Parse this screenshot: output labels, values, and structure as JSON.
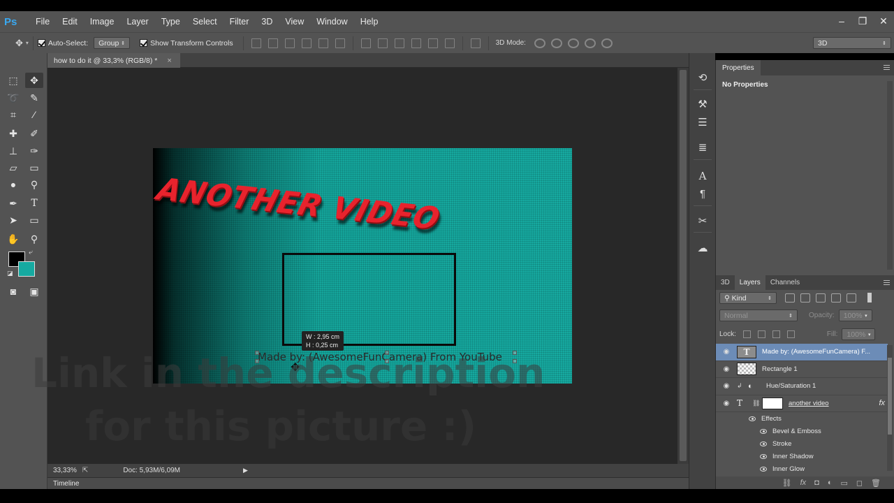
{
  "app": {
    "logo": "Ps",
    "menu": [
      "File",
      "Edit",
      "Image",
      "Layer",
      "Type",
      "Select",
      "Filter",
      "3D",
      "View",
      "Window",
      "Help"
    ],
    "window_controls": {
      "minimize": "–",
      "restore": "❐",
      "close": "✕"
    }
  },
  "options_bar": {
    "auto_select_label": "Auto-Select:",
    "auto_select_value": "Group",
    "show_transform_label": "Show Transform Controls",
    "mode_3d_label": "3D Mode:",
    "workspace_value": "3D"
  },
  "document": {
    "tab_title": "how to do it @ 33,3% (RGB/8) *",
    "tab_close": "×",
    "zoom": "33,33%",
    "doc_info": "Doc: 5,93M/6,09M",
    "timeline_label": "Timeline"
  },
  "canvas": {
    "title_text": "ANOTHER VIDEO",
    "credit_text": "Made by: (AwesomeFunCamera) From YouTube",
    "tooltip_w": "W :  2,95 cm",
    "tooltip_h": "H :  0,25 cm"
  },
  "overlay": {
    "line1": "Link in the description",
    "line2": "for this picture :)"
  },
  "properties": {
    "tab": "Properties",
    "body": "No Properties"
  },
  "layers_panel": {
    "tabs": [
      "3D",
      "Layers",
      "Channels"
    ],
    "active_tab": "Layers",
    "kind_label": "Kind",
    "blend_mode": "Normal",
    "opacity_label": "Opacity:",
    "opacity_value": "100%",
    "lock_label": "Lock:",
    "fill_label": "Fill:",
    "fill_value": "100%",
    "layers": [
      {
        "name": "Made by: (AwesomeFunCamera) F...",
        "type": "text",
        "selected": true
      },
      {
        "name": "Rectangle 1",
        "type": "shape",
        "selected": false
      },
      {
        "name": "Hue/Saturation 1",
        "type": "adjustment",
        "selected": false
      },
      {
        "name": "another video",
        "type": "text-fx",
        "selected": false
      }
    ],
    "effects_label": "Effects",
    "effects": [
      "Bevel & Emboss",
      "Stroke",
      "Inner Shadow",
      "Inner Glow"
    ],
    "fx_label": "fx"
  },
  "colors": {
    "canvas_teal": "#16aaa1",
    "title_red": "#e8232d",
    "selected_layer": "#6c8cb7",
    "foreground": "#000000",
    "background": "#16aaa1"
  }
}
